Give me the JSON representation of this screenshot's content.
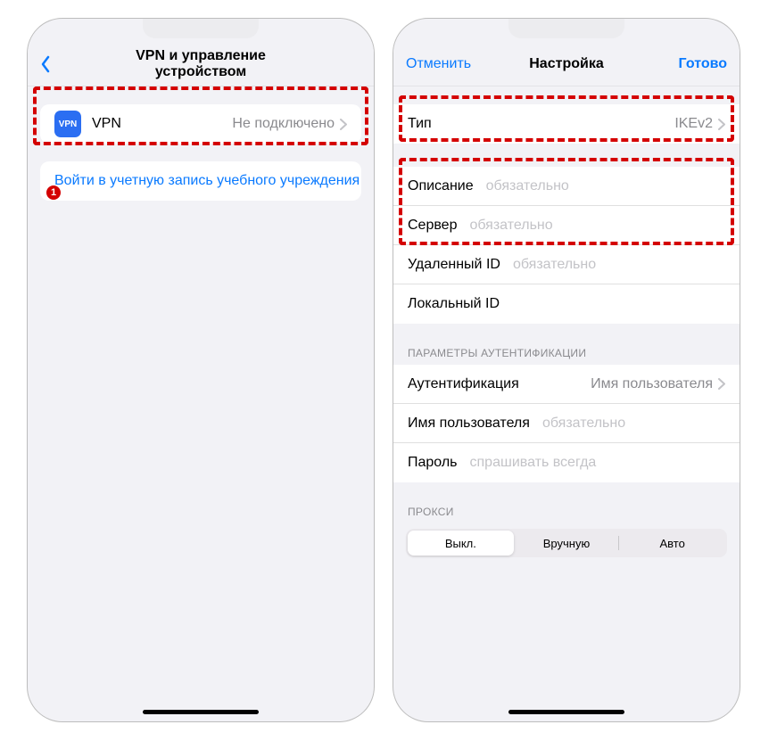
{
  "left": {
    "nav_title": "VPN и управление устройством",
    "vpn_row": {
      "label": "VPN",
      "value": "Не подключено",
      "icon_text": "VPN"
    },
    "signin_row": {
      "label": "Войти в учетную запись учебного учреждения или организации..."
    },
    "badge": "1"
  },
  "right": {
    "nav_cancel": "Отменить",
    "nav_title": "Настройка",
    "nav_done": "Готово",
    "type_row": {
      "label": "Тип",
      "value": "IKEv2"
    },
    "fields": [
      {
        "label": "Описание",
        "placeholder": "обязательно"
      },
      {
        "label": "Сервер",
        "placeholder": "обязательно"
      },
      {
        "label": "Удаленный ID",
        "placeholder": "обязательно"
      },
      {
        "label": "Локальный ID",
        "placeholder": ""
      }
    ],
    "auth_header": "ПАРАМЕТРЫ АУТЕНТИФИКАЦИИ",
    "auth_type": {
      "label": "Аутентификация",
      "value": "Имя пользователя"
    },
    "auth_user": {
      "label": "Имя пользователя",
      "placeholder": "обязательно"
    },
    "auth_pass": {
      "label": "Пароль",
      "placeholder": "спрашивать всегда"
    },
    "proxy_header": "ПРОКСИ",
    "proxy_segments": [
      "Выкл.",
      "Вручную",
      "Авто"
    ],
    "proxy_active_index": 0
  }
}
